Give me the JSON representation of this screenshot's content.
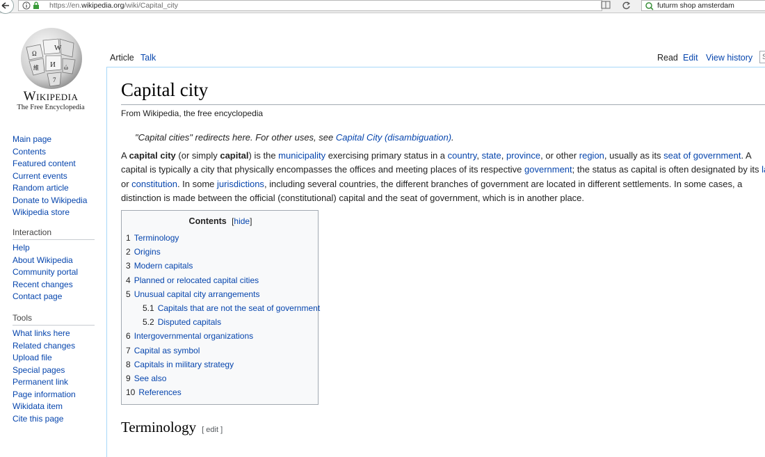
{
  "browser": {
    "url_prefix": "https://en.",
    "url_domain": "wikipedia.org",
    "url_path": "/wiki/Capital_city",
    "search_query": "futurm shop amsterdam"
  },
  "wiki": {
    "wordmark": "Wikipedia",
    "tagline": "The Free Encyclopedia"
  },
  "sidebar": {
    "navigation": [
      "Main page",
      "Contents",
      "Featured content",
      "Current events",
      "Random article",
      "Donate to Wikipedia",
      "Wikipedia store"
    ],
    "interaction_heading": "Interaction",
    "interaction": [
      "Help",
      "About Wikipedia",
      "Community portal",
      "Recent changes",
      "Contact page"
    ],
    "tools_heading": "Tools",
    "tools": [
      "What links here",
      "Related changes",
      "Upload file",
      "Special pages",
      "Permanent link",
      "Page information",
      "Wikidata item",
      "Cite this page"
    ]
  },
  "tabs": {
    "article": "Article",
    "talk": "Talk",
    "read": "Read",
    "edit": "Edit",
    "history": "View history",
    "search_placeholder": "S"
  },
  "article": {
    "title": "Capital city",
    "from": "From Wikipedia, the free encyclopedia",
    "hatnote_text": "\"Capital cities\" redirects here. For other uses, see ",
    "hatnote_link": "Capital City (disambiguation)",
    "hatnote_end": ".",
    "p": {
      "t1": "A ",
      "b1": "capital city",
      "t2": " (or simply ",
      "b2": "capital",
      "t3": ") is the ",
      "l_municipality": "municipality",
      "t4": " exercising primary status in a ",
      "l_country": "country",
      "c1": ", ",
      "l_state": "state",
      "c2": ", ",
      "l_province": "province",
      "t5": ", or other ",
      "l_region": "region",
      "t6": ", usually as its ",
      "l_seat": "seat of government",
      "t7": ". A",
      "t8": "capital is typically a city that physically encompasses the offices and meeting places of its respective ",
      "l_government": "government",
      "t9": "; the status as capital is often designated by its ",
      "l_law": "law",
      "t10": "or ",
      "l_constitution": "constitution",
      "t11": ". In some ",
      "l_jurisdictions": "jurisdictions",
      "t12": ", including several countries, the different branches of government are located in different settlements. In some cases, a",
      "t13": "distinction is made between the official (constitutional) capital and the seat of government, which is in another place."
    },
    "section_heading": "Terminology",
    "section_edit": "[ edit ]"
  },
  "toc": {
    "title": "Contents",
    "hide": "hide",
    "bracket_open": "[",
    "bracket_close": "]",
    "entries": [
      {
        "num": "1",
        "text": "Terminology"
      },
      {
        "num": "2",
        "text": "Origins"
      },
      {
        "num": "3",
        "text": "Modern capitals"
      },
      {
        "num": "4",
        "text": "Planned or relocated capital cities"
      },
      {
        "num": "5",
        "text": "Unusual capital city arrangements"
      },
      {
        "num": "5.1",
        "text": "Capitals that are not the seat of government"
      },
      {
        "num": "5.2",
        "text": "Disputed capitals"
      },
      {
        "num": "6",
        "text": "Intergovernmental organizations"
      },
      {
        "num": "7",
        "text": "Capital as symbol"
      },
      {
        "num": "8",
        "text": "Capitals in military strategy"
      },
      {
        "num": "9",
        "text": "See also"
      },
      {
        "num": "10",
        "text": "References"
      }
    ]
  },
  "colors": {
    "link": "#0645ad",
    "content_border": "#a7d7f9",
    "toc_bg": "#f8f9fa"
  }
}
